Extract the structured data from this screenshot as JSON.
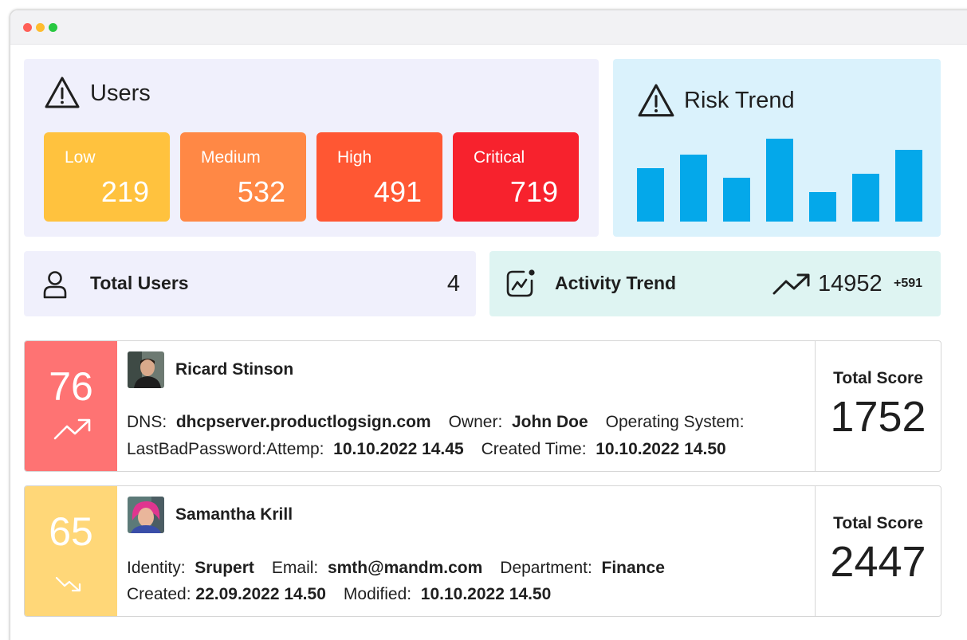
{
  "users_panel": {
    "title": "Users",
    "icon": "warning-icon",
    "levels": [
      {
        "label": "Low",
        "value": "219",
        "color": "#ffc23e"
      },
      {
        "label": "Medium",
        "value": "532",
        "color": "#ff8845"
      },
      {
        "label": "High",
        "value": "491",
        "color": "#ff5733"
      },
      {
        "label": "Critical",
        "value": "719",
        "color": "#f7222d"
      }
    ]
  },
  "risk_trend": {
    "title": "Risk Trend",
    "icon": "warning-icon",
    "chart_data": {
      "type": "bar",
      "values": [
        67,
        84,
        55,
        104,
        37,
        60,
        90
      ],
      "color": "#04a8ea"
    }
  },
  "total_users": {
    "label": "Total Users",
    "value": "4",
    "icon": "user-icon"
  },
  "activity_trend": {
    "label": "Activity Trend",
    "icon": "activity-chart-icon",
    "trend_icon": "trending-up-icon",
    "value": "14952",
    "delta": "+591"
  },
  "user_cards": [
    {
      "score": "76",
      "score_color": "#fe7373",
      "trend_icon": "trending-up-icon",
      "name": "Ricard Stinson",
      "line1": [
        {
          "k": "DNS:",
          "v": "dhcpserver.productlogsign.com"
        },
        {
          "k": "Owner:",
          "v": "John Doe"
        },
        {
          "k": "Operating System:",
          "v": ""
        }
      ],
      "line2": [
        {
          "k": "LastBadPassword:Attemp:",
          "v": "10.10.2022 14.45"
        },
        {
          "k": "Created Time:",
          "v": "10.10.2022 14.50"
        }
      ],
      "total_label": "Total Score",
      "total_value": "1752"
    },
    {
      "score": "65",
      "score_color": "#ffd778",
      "trend_icon": "trending-down-icon",
      "name": "Samantha Krill",
      "line1": [
        {
          "k": "Identity:",
          "v": "Srupert"
        },
        {
          "k": "Email:",
          "v": "smth@mandm.com"
        },
        {
          "k": "Department:",
          "v": "Finance"
        }
      ],
      "line2": [
        {
          "k": "Created:",
          "v": "22.09.2022 14.50"
        },
        {
          "k": "Modified:",
          "v": "10.10.2022 14.50"
        }
      ],
      "total_label": "Total Score",
      "total_value": "2447"
    }
  ]
}
